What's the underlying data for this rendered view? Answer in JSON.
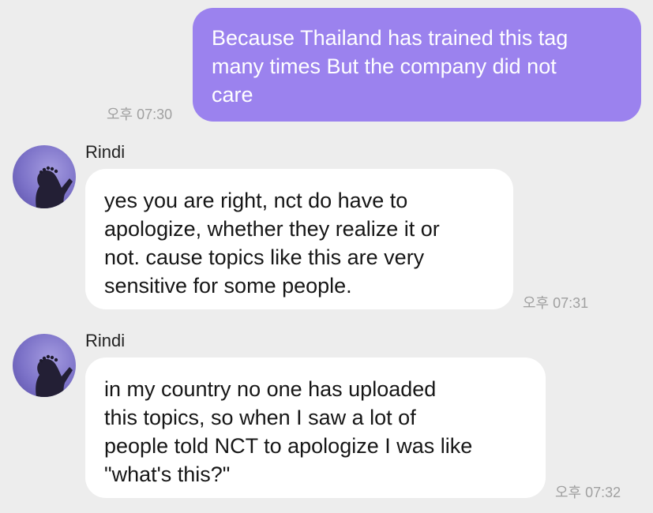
{
  "chat": {
    "messages": [
      {
        "direction": "outgoing",
        "text": "Because Thailand has trained this tag\nmany times  But the company did not\ncare",
        "time": "오후 07:30"
      },
      {
        "direction": "incoming",
        "sender": "Rindi",
        "avatar_icon": "profile-photo-silhouette-with-flower-crown",
        "text": "yes you are right, nct do have to\napologize, whether they realize it or\nnot. cause topics like this are very\nsensitive for some people.",
        "time": "오후 07:31"
      },
      {
        "direction": "incoming",
        "sender": "Rindi",
        "avatar_icon": "profile-photo-silhouette-with-flower-crown",
        "text": "in my country no one has uploaded\nthis topics, so when I saw a lot of\npeople told NCT to apologize I was like\n\"what's this?\"",
        "time": "오후 07:32"
      }
    ]
  },
  "colors": {
    "background": "#ededed",
    "outgoing_bubble": "#9b82ee",
    "incoming_bubble": "#ffffff",
    "timestamp": "#a0a0a0"
  }
}
